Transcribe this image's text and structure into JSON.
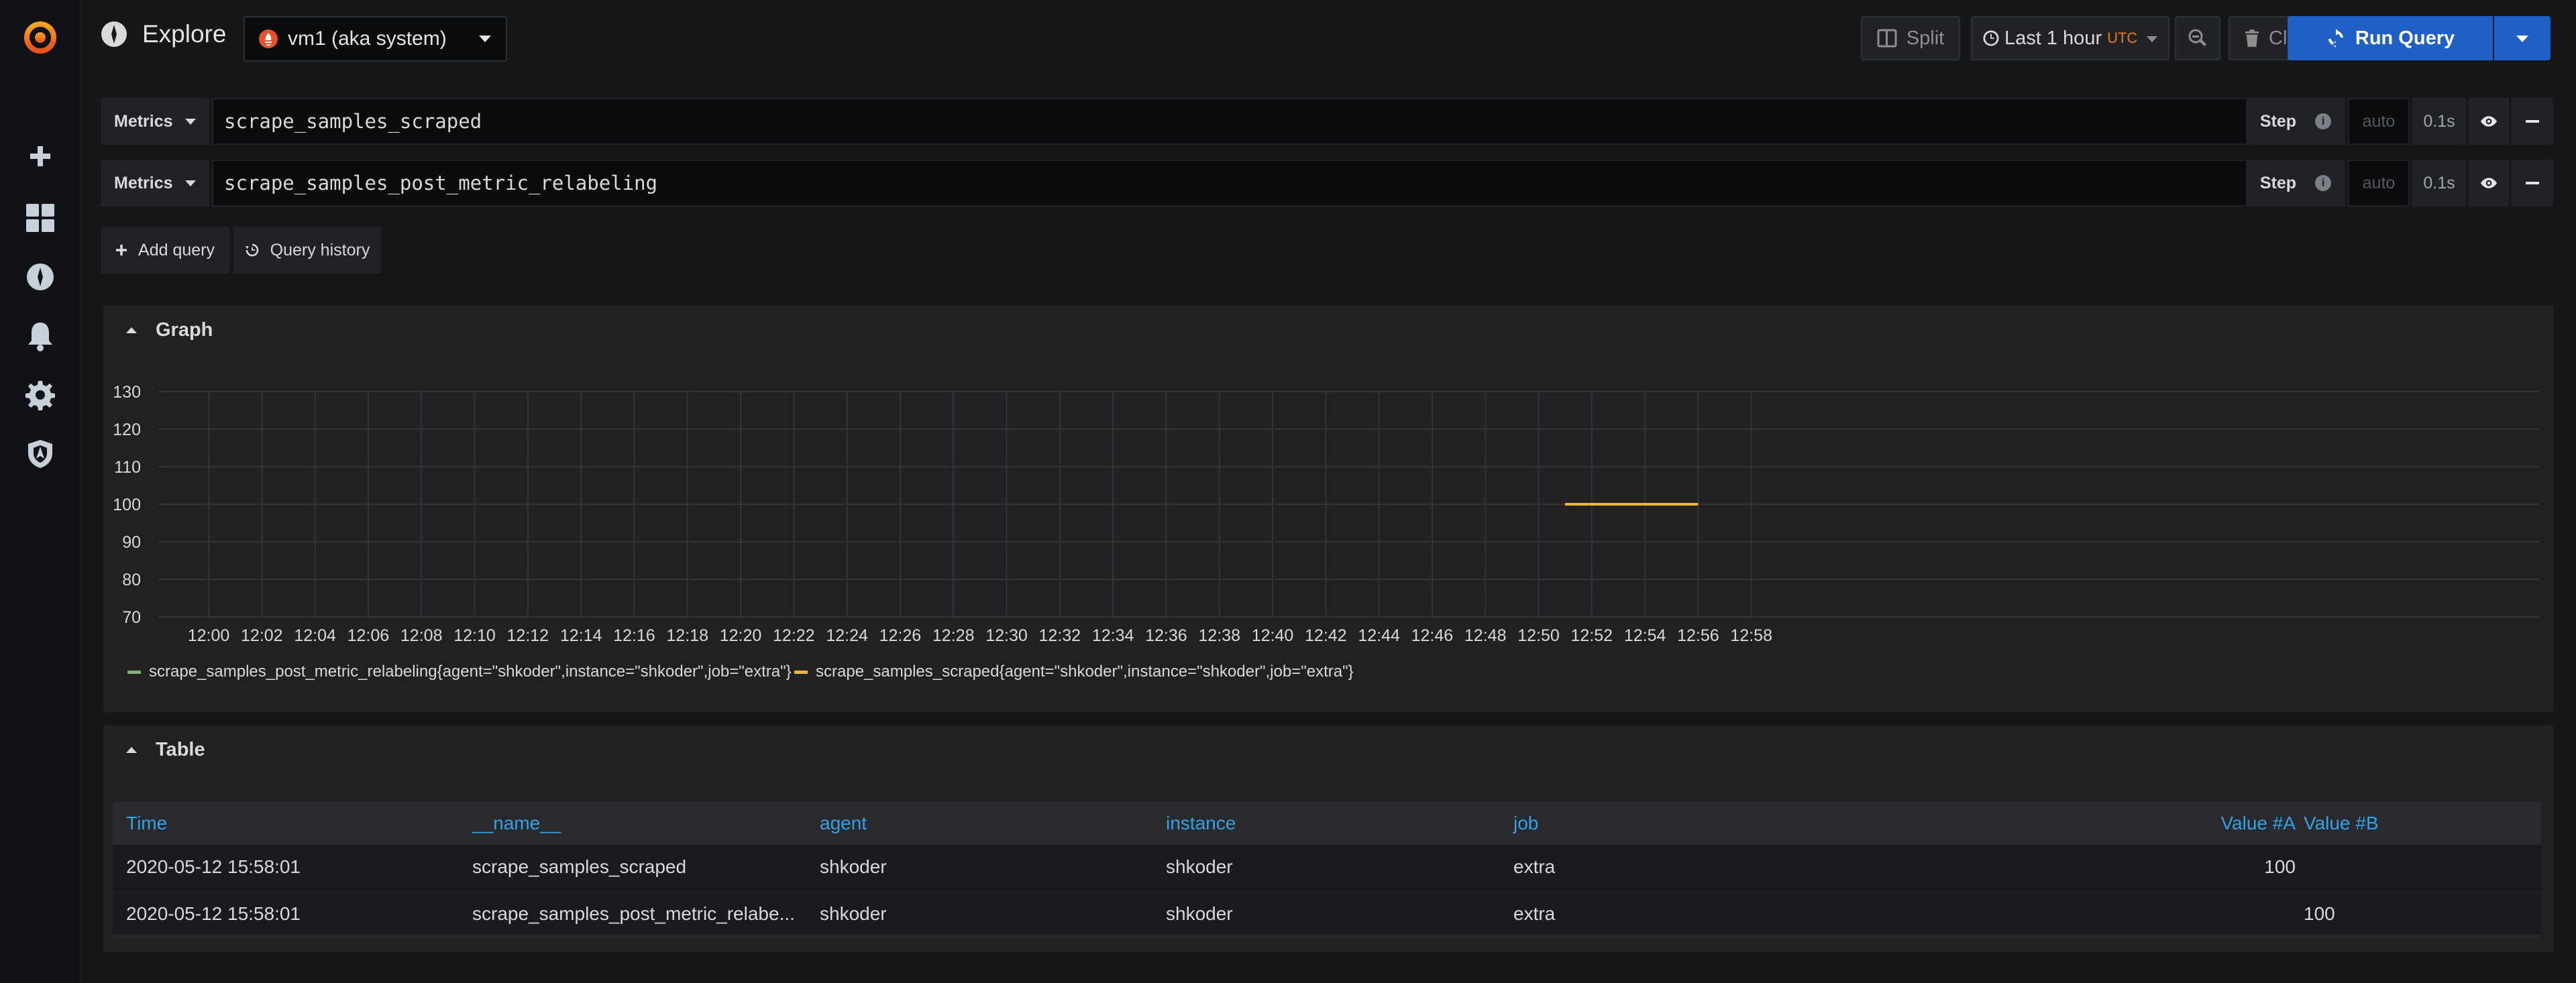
{
  "app": {
    "title": "Explore"
  },
  "datasource": {
    "label": "vm1 (aka system)"
  },
  "toolbar": {
    "split_label": "Split",
    "time_label": "Last 1 hour",
    "time_zone": "UTC",
    "clear_label": "Clear All",
    "run_label": "Run Query"
  },
  "queries": [
    {
      "type_label": "Metrics",
      "expr": "scrape_samples_scraped",
      "step_label": "Step",
      "step_placeholder": "auto",
      "resolution": "0.1s"
    },
    {
      "type_label": "Metrics",
      "expr": "scrape_samples_post_metric_relabeling",
      "step_label": "Step",
      "step_placeholder": "auto",
      "resolution": "0.1s"
    }
  ],
  "actions": {
    "add_query": "Add query",
    "query_history": "Query history"
  },
  "graph_panel": {
    "title": "Graph"
  },
  "table_panel": {
    "title": "Table"
  },
  "colors": {
    "accent": "#1f60c4",
    "series_green": "#7eb26d",
    "series_yellow": "#eab839",
    "link": "#33a2e5"
  },
  "chart_data": {
    "type": "line",
    "x": [
      "12:00",
      "12:02",
      "12:04",
      "12:06",
      "12:08",
      "12:10",
      "12:12",
      "12:14",
      "12:16",
      "12:18",
      "12:20",
      "12:22",
      "12:24",
      "12:26",
      "12:28",
      "12:30",
      "12:32",
      "12:34",
      "12:36",
      "12:38",
      "12:40",
      "12:42",
      "12:44",
      "12:46",
      "12:48",
      "12:50",
      "12:52",
      "12:54",
      "12:56",
      "12:58"
    ],
    "y_ticks": [
      130,
      120,
      110,
      100,
      90,
      80,
      70
    ],
    "ylim": [
      70,
      130
    ],
    "series": [
      {
        "name": "scrape_samples_post_metric_relabeling{agent=\"shkoder\",instance=\"shkoder\",job=\"extra\"}",
        "color": "#7eb26d",
        "points": [
          [
            "12:51",
            100
          ],
          [
            "12:56",
            100
          ]
        ]
      },
      {
        "name": "scrape_samples_scraped{agent=\"shkoder\",instance=\"shkoder\",job=\"extra\"}",
        "color": "#eab839",
        "points": [
          [
            "12:51",
            100
          ],
          [
            "12:56",
            100
          ]
        ]
      }
    ],
    "grid": true,
    "legend": "bottom-left"
  },
  "table": {
    "columns": [
      "Time",
      "__name__",
      "agent",
      "instance",
      "job",
      "Value #A",
      "Value #B"
    ],
    "rows": [
      [
        "2020-05-12 15:58:01",
        "scrape_samples_scraped",
        "shkoder",
        "shkoder",
        "extra",
        "100",
        ""
      ],
      [
        "2020-05-12 15:58:01",
        "scrape_samples_post_metric_relabe...",
        "shkoder",
        "shkoder",
        "extra",
        "",
        "100"
      ]
    ]
  }
}
